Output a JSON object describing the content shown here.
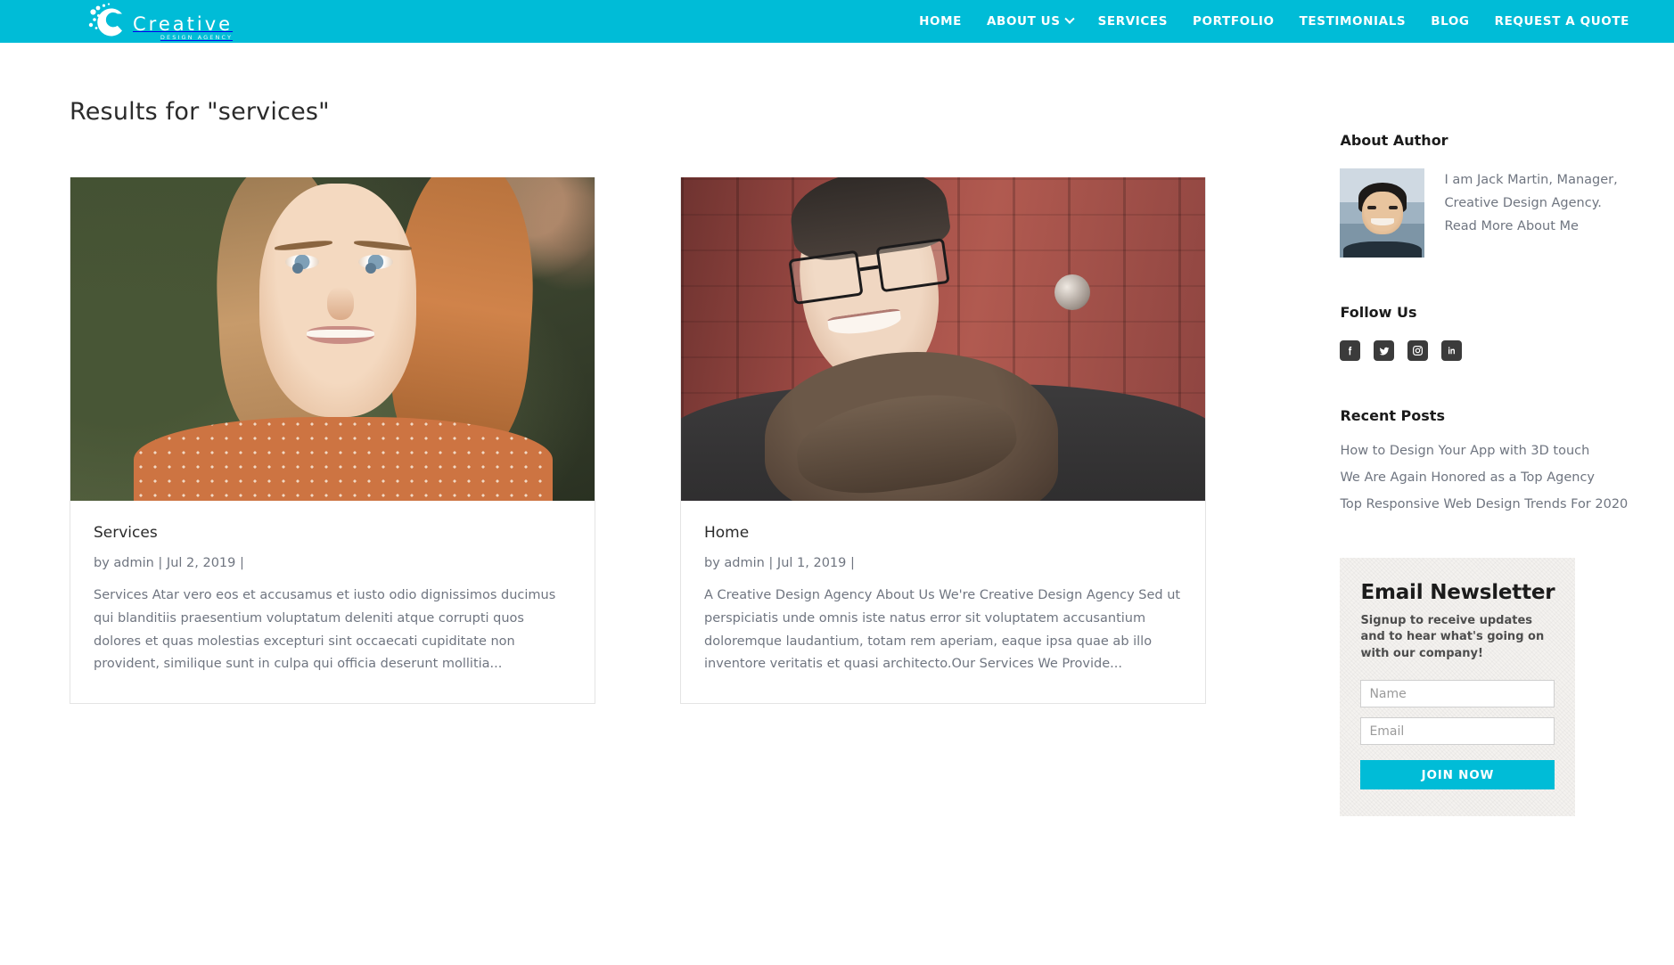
{
  "theme": {
    "accent": "#00bcd7",
    "text_dark": "#2b2b2b",
    "text_muted": "#6f7580",
    "social_bg": "#3b3b3b",
    "newsletter_bg": "#f4f2ef"
  },
  "header": {
    "logo_word": "Creative",
    "logo_sub": "DESIGN AGENCY",
    "nav": [
      {
        "label": "HOME",
        "has_dropdown": false
      },
      {
        "label": "ABOUT US",
        "has_dropdown": true
      },
      {
        "label": "SERVICES",
        "has_dropdown": false
      },
      {
        "label": "PORTFOLIO",
        "has_dropdown": false
      },
      {
        "label": "TESTIMONIALS",
        "has_dropdown": false
      },
      {
        "label": "BLOG",
        "has_dropdown": false
      },
      {
        "label": "REQUEST A QUOTE",
        "has_dropdown": false
      }
    ]
  },
  "main": {
    "page_title": "Results for \"services\"",
    "results": [
      {
        "title": "Services",
        "meta": "by admin  |  Jul 2, 2019  |",
        "excerpt": "Services Atar vero eos et accusamus et iusto odio dignissimos ducimus qui blanditiis praesentium voluptatum deleniti atque corrupti quos dolores et quas molestias excepturi sint occaecati cupiditate non provident, similique sunt in culpa qui officia deserunt mollitia...",
        "image_name": "smiling-woman-photo"
      },
      {
        "title": "Home",
        "meta": "by admin  |  Jul 1, 2019  |",
        "excerpt": "A Creative Design Agency About Us We're Creative Design Agency Sed ut perspiciatis unde omnis iste natus error sit voluptatem accusantium doloremque laudantium, totam rem aperiam, eaque ipsa quae ab illo inventore veritatis et quasi architecto.Our Services We Provide...",
        "image_name": "smiling-man-with-glasses-photo"
      }
    ]
  },
  "sidebar": {
    "about_author": {
      "title": "About Author",
      "text": "I am Jack Martin, Manager, Creative Design Agency. Read More About Me",
      "avatar_name": "author-avatar"
    },
    "follow_us": {
      "title": "Follow Us",
      "socials": [
        {
          "name": "facebook-icon",
          "label": "Facebook"
        },
        {
          "name": "twitter-icon",
          "label": "Twitter"
        },
        {
          "name": "instagram-icon",
          "label": "Instagram"
        },
        {
          "name": "linkedin-icon",
          "label": "LinkedIn"
        }
      ]
    },
    "recent_posts": {
      "title": "Recent Posts",
      "items": [
        "How to Design Your App with 3D touch",
        "We Are Again Honored as a Top Agency",
        "Top Responsive Web Design Trends For 2020"
      ]
    },
    "newsletter": {
      "title": "Email Newsletter",
      "subtitle": "Signup to receive updates and to hear what's going on with our company!",
      "name_placeholder": "Name",
      "name_value": "",
      "email_placeholder": "Email",
      "email_value": "",
      "button_label": "JOIN NOW"
    }
  }
}
